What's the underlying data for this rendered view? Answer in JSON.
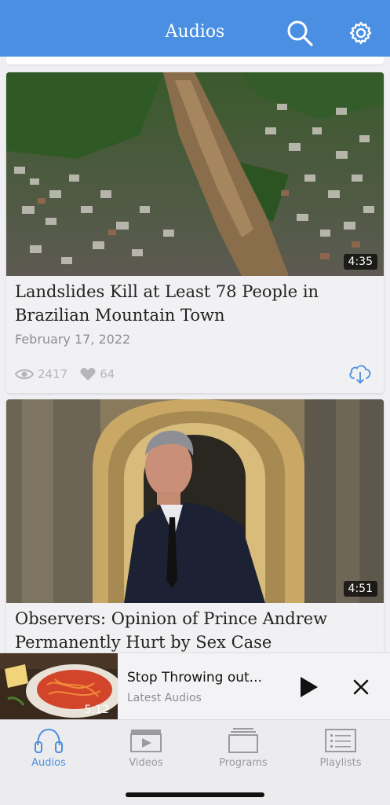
{
  "header": {
    "title": "Audios",
    "search_icon": "search-icon",
    "settings_icon": "gear-icon",
    "color": "#4a8fe2"
  },
  "feed": {
    "items": [
      {
        "duration": "4:35",
        "title": "Landslides Kill at Least 78 People in Brazilian Mountain Town",
        "date": "February 17, 2022",
        "views": "2417",
        "likes": "64",
        "download_icon": "cloud-download-icon"
      },
      {
        "duration": "4:51",
        "title": "Observers: Opinion of Prince Andrew Permanently Hurt by Sex Case"
      }
    ]
  },
  "mini_player": {
    "duration": "5:12",
    "title": "Stop Throwing out...",
    "subtitle": "Latest Audios",
    "play_icon": "play-icon",
    "close_icon": "close-icon"
  },
  "tabbar": {
    "tabs": [
      {
        "label": "Audios",
        "icon": "headphones-icon",
        "active": true
      },
      {
        "label": "Videos",
        "icon": "clapperboard-icon",
        "active": false
      },
      {
        "label": "Programs",
        "icon": "stack-icon",
        "active": false
      },
      {
        "label": "Playlists",
        "icon": "list-icon",
        "active": false
      }
    ],
    "active_color": "#4a8fe2"
  }
}
